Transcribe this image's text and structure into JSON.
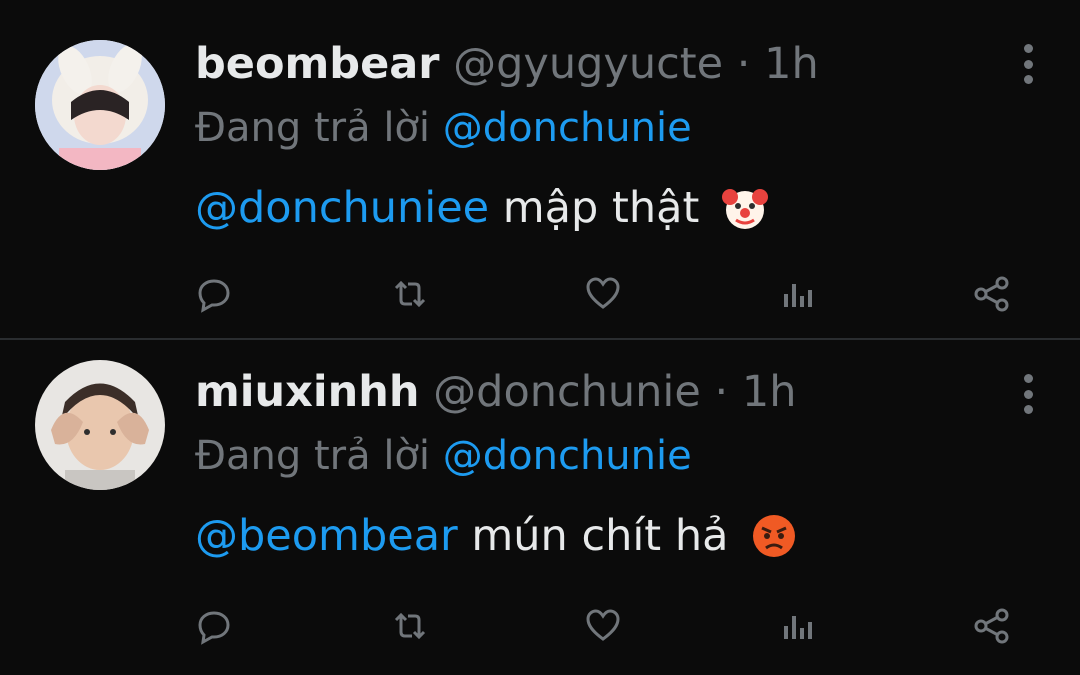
{
  "tweets": [
    {
      "name": "beombear",
      "handle": "@gyugyucte",
      "separator": "·",
      "time": "1h",
      "reply_prefix": "Đang trả lời",
      "reply_to": "@donchunie",
      "mention": "@donchuniee",
      "text": "mập thật",
      "emoji": "clown-face-emoji"
    },
    {
      "name": "miuxinhh",
      "handle": "@donchunie",
      "separator": "·",
      "time": "1h",
      "reply_prefix": "Đang trả lời",
      "reply_to": "@donchunie",
      "mention": "@beombear",
      "text": "mún chít hả",
      "emoji": "angry-face-emoji"
    }
  ],
  "icons": [
    "reply-icon",
    "retweet-icon",
    "like-icon",
    "analytics-icon",
    "share-icon"
  ],
  "colors": {
    "background": "#0b0b0b",
    "text": "#e7e9ea",
    "muted": "#71767b",
    "link": "#1d9bf0"
  }
}
